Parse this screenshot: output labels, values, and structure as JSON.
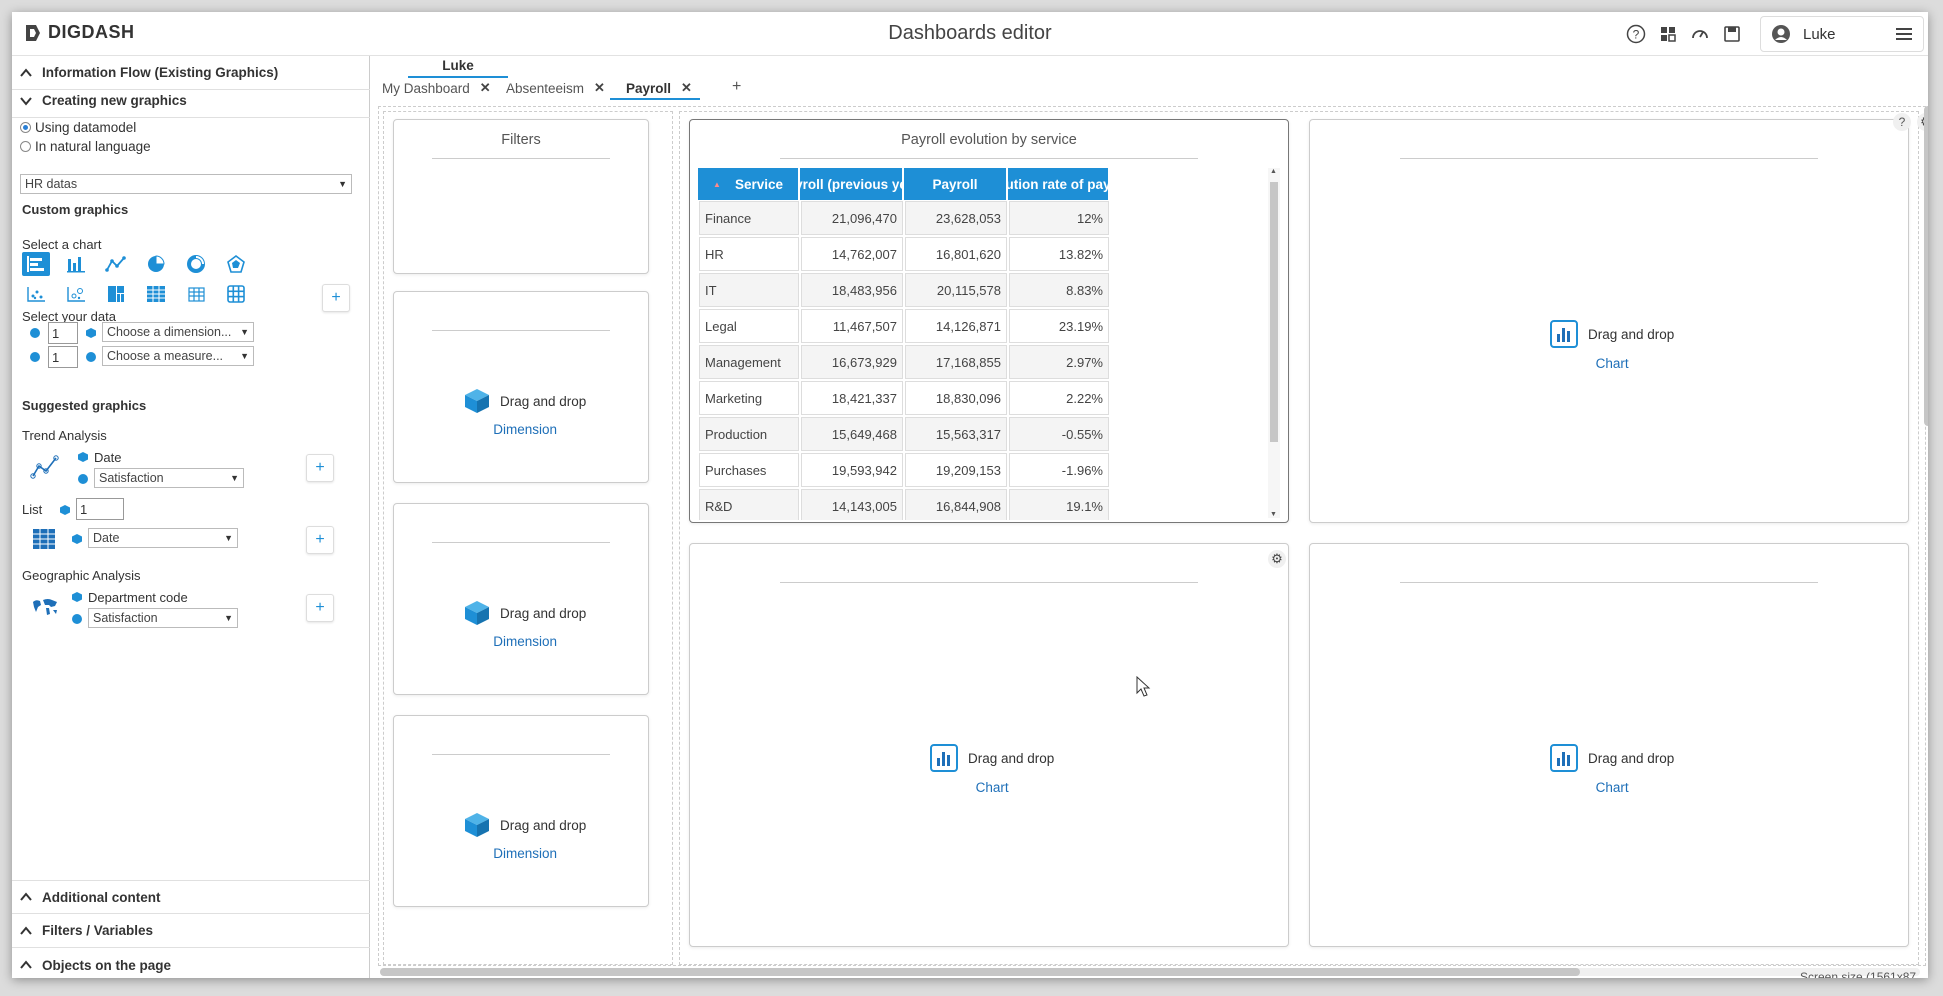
{
  "header": {
    "logo_text": "DIGDASH",
    "title": "Dashboards editor",
    "user": "Luke"
  },
  "left": {
    "sections_top": [
      "Information Flow (Existing Graphics)",
      "Creating new graphics"
    ],
    "radio_datamodel": "Using datamodel",
    "radio_natural": "In natural language",
    "datamodel_select": "HR datas",
    "custom_graphics": "Custom graphics",
    "select_chart": "Select a chart",
    "select_data": "Select your data",
    "dim_count": "1",
    "dim_select": "Choose a dimension...",
    "meas_count": "1",
    "meas_select": "Choose a measure...",
    "suggested": "Suggested graphics",
    "trend": {
      "title": "Trend Analysis",
      "dim": "Date",
      "measure": "Satisfaction"
    },
    "list": {
      "title": "List",
      "count": "1",
      "dim": "Date"
    },
    "geo": {
      "title": "Geographic Analysis",
      "dim": "Department code",
      "measure": "Satisfaction"
    },
    "sections_bottom": [
      "Additional content",
      "Filters / Variables",
      "Objects on the page"
    ]
  },
  "tabs": {
    "owner": "Luke",
    "items": [
      {
        "label": "My Dashboard"
      },
      {
        "label": "Absenteeism"
      },
      {
        "label": "Payroll"
      }
    ],
    "add": "+"
  },
  "filters_title": "Filters",
  "drag_drop": "Drag and drop",
  "dimension_link": "Dimension",
  "chart_link": "Chart",
  "payroll": {
    "title": "Payroll evolution by service",
    "columns": [
      "Service",
      "yroll (previous ye",
      "Payroll",
      "ution rate of pay"
    ],
    "rows": [
      [
        "Finance",
        "21,096,470",
        "23,628,053",
        "12%"
      ],
      [
        "HR",
        "14,762,007",
        "16,801,620",
        "13.82%"
      ],
      [
        "IT",
        "18,483,956",
        "20,115,578",
        "8.83%"
      ],
      [
        "Legal",
        "11,467,507",
        "14,126,871",
        "23.19%"
      ],
      [
        "Management",
        "16,673,929",
        "17,168,855",
        "2.97%"
      ],
      [
        "Marketing",
        "18,421,337",
        "18,830,096",
        "2.22%"
      ],
      [
        "Production",
        "15,649,468",
        "15,563,317",
        "-0.55%"
      ],
      [
        "Purchases",
        "19,593,942",
        "19,209,153",
        "-1.96%"
      ],
      [
        "R&D",
        "14,143,005",
        "16,844,908",
        "19.1%"
      ]
    ]
  },
  "screen_size": "Screen size (1561x87",
  "colors": {
    "accent": "#1e8fd6",
    "link": "#1e6fb8"
  }
}
